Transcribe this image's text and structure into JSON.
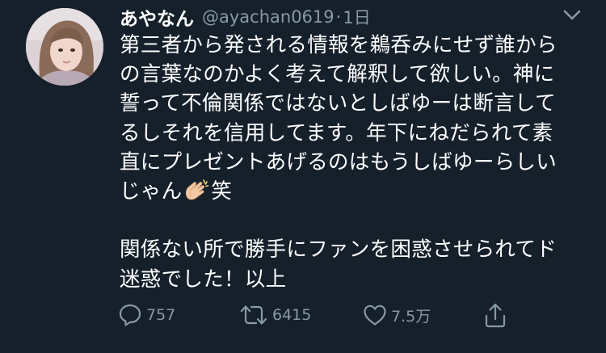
{
  "tweet": {
    "display_name": "あやなん",
    "handle": "@ayachan0619",
    "separator": "·",
    "timestamp": "1日",
    "lines": [
      "第三者から発される情報を鵜呑みにせず誰から",
      "の言葉なのかよく考えて解釈して欲しい。神に",
      "誓って不倫関係ではないとしばゆーは断言して",
      "るしそれを信用してます。年下にねだられて素",
      "直にプレゼントあげるのはもうしばゆーらしい"
    ],
    "line6_before": "じゃん",
    "line6_emoji": "clapping-hands-icon",
    "line6_after": "笑",
    "lines_after_blank": [
      "関係ない所で勝手にファンを困惑させられてド",
      "迷惑でした！以上"
    ]
  },
  "actions": {
    "reply_count": "757",
    "retweet_count": "6415",
    "like_count": "7.5万",
    "reply_icon": "reply-icon",
    "retweet_icon": "retweet-icon",
    "like_icon": "heart-icon",
    "share_icon": "share-icon"
  },
  "colors": {
    "background": "#15202b",
    "text": "#ffffff",
    "secondary": "#8899a6"
  }
}
